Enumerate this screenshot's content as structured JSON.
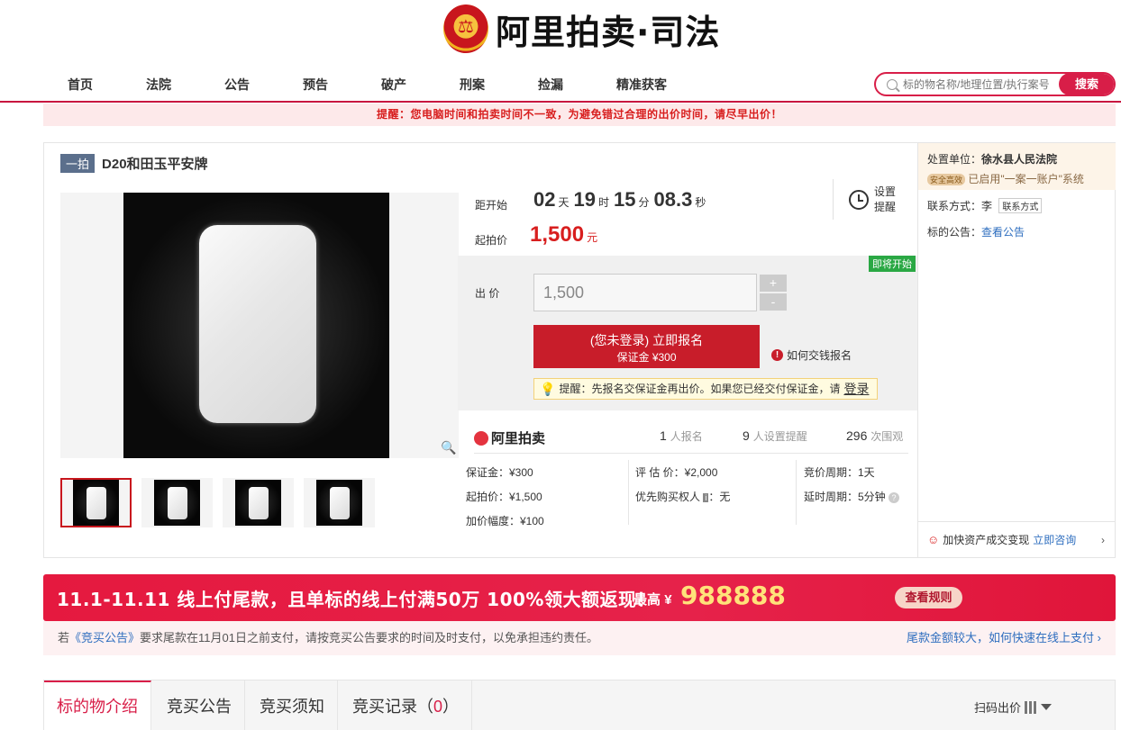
{
  "brand": {
    "logo_text": "阿里拍卖·司法"
  },
  "nav": {
    "items": [
      "首页",
      "法院",
      "公告",
      "预告",
      "破产",
      "刑案",
      "捡漏",
      "精准获客"
    ]
  },
  "search": {
    "placeholder": "标的物名称/地理位置/执行案号",
    "button": "搜索"
  },
  "warning": "提醒：您电脑时间和拍卖时间不一致，为避免错过合理的出价时间，请尽早出价！",
  "lot": {
    "tag": "一拍",
    "title": "D20和田玉平安牌",
    "countdown_label": "距开始",
    "countdown": {
      "days": "02",
      "days_unit": "天",
      "hours": "19",
      "hours_unit": "时",
      "minutes": "15",
      "minutes_unit": "分",
      "seconds": "08.3",
      "seconds_unit": "秒"
    },
    "remind": "设置提醒",
    "start_label": "起拍价",
    "start_price": "1,500",
    "start_price_unit": "元",
    "soon_badge": "即将开始",
    "bid_label": "出 价",
    "bid_value": "1,500",
    "plus": "+",
    "minus": "-",
    "signup_line1": "(您未登录) 立即报名",
    "signup_line2": "保证金 ¥300",
    "howto": "如何交钱报名",
    "tip_text": "提醒：先报名交保证金再出价。如果您已经交付保证金，请",
    "tip_link": "登录",
    "platform": "阿里拍卖",
    "stats": [
      {
        "num": "1",
        "label": "人报名"
      },
      {
        "num": "9",
        "label": "人设置提醒"
      },
      {
        "num": "296",
        "label": "次围观"
      }
    ],
    "info": {
      "deposit": "保证金：¥300",
      "start": "起拍价：¥1,500",
      "increment": "加价幅度：¥100",
      "appraisal": "评 估 价：¥2,000",
      "priority_label": "优先购买权人",
      "priority_badge": "i",
      "priority_value": "：无",
      "cycle": "竞价周期：1天",
      "delay": "延时周期：5分钟",
      "help": "?"
    }
  },
  "court_panel": {
    "unit_label": "处置单位：",
    "unit": "徐水县人民法院",
    "safe_badge": "安全高效",
    "account": "已启用\"一案一账户\"系统",
    "contact_label": "联系方式：李",
    "contact_btn": "联系方式",
    "notice_label": "标的公告：",
    "notice_link": "查看公告",
    "asset_text": "加快资产成交变现",
    "asset_link": "立即咨询",
    "arrow": "›"
  },
  "promo": {
    "text": "11.1-11.11 线上付尾款，且单标的线上付满50万 100%领大额返现！",
    "max_label": "最高",
    "currency": "¥",
    "amount": "988888",
    "button": "查看规则",
    "note_pre": "若",
    "note_link": "《竞买公告》",
    "note_post": "要求尾款在11月01日之前支付，请按竞买公告要求的时间及时支付，以免承担违约责任。",
    "note_right": "尾款金额较大，如何快速在线上支付 ›"
  },
  "tabs": {
    "items": [
      "标的物介绍",
      "竞买公告",
      "竞买须知",
      "竞买记录（"
    ],
    "record_count": "0",
    "record_close": "）",
    "scan": "扫码出价"
  },
  "colors": {
    "accent": "#d81e48",
    "price": "#d81e1e",
    "button": "#c81d2a",
    "badge_green": "#2aa844"
  }
}
